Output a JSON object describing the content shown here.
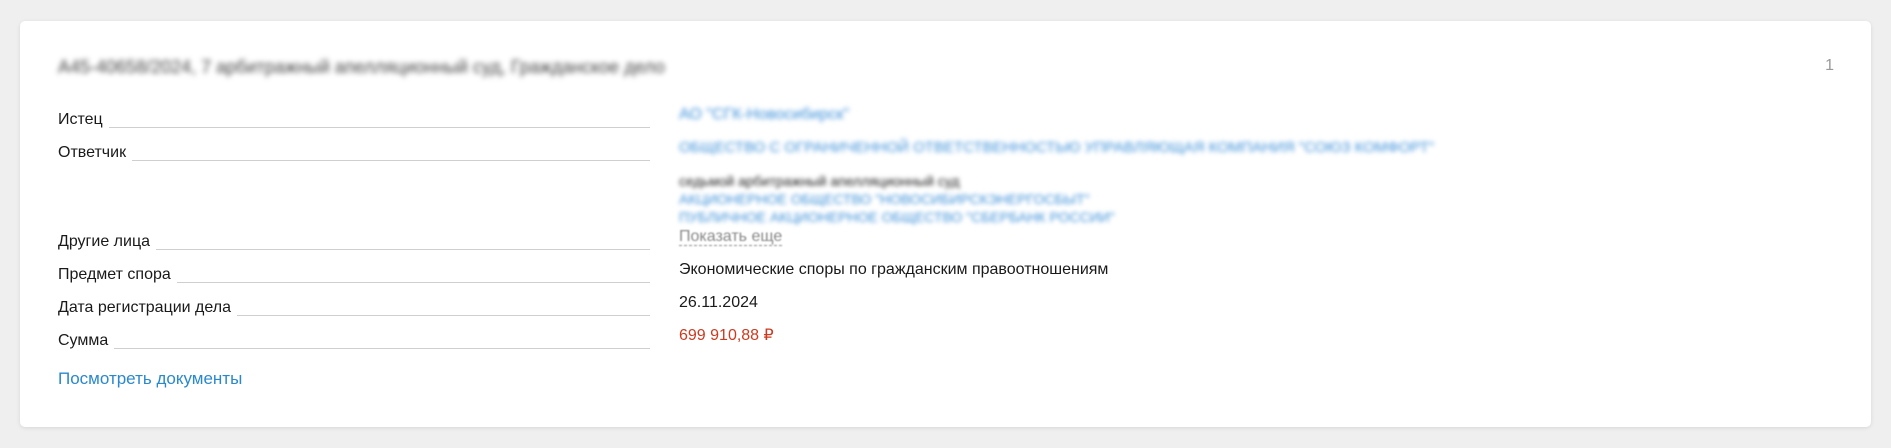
{
  "case": {
    "title": "А45-40658/2024, 7 арбитражный апелляционный суд, Гражданское дело",
    "page_number": "1"
  },
  "rows": {
    "plaintiff": {
      "label": "Истец",
      "value": "АО \"СГК-Новосибирск\""
    },
    "defendant": {
      "label": "Ответчик",
      "value": "ОБЩЕСТВО С ОГРАНИЧЕННОЙ ОТВЕТСТВЕННОСТЬЮ УПРАВЛЯЮЩАЯ КОМПАНИЯ \"СОЮЗ КОМФОРТ\""
    },
    "other_parties": {
      "label": "Другие лица",
      "court": "седьмой арбитражный апелляционный суд",
      "party_1": "АКЦИОНЕРНОЕ ОБЩЕСТВО \"НОВОСИБИРСКЭНЕРГОСБЫТ\"",
      "party_2": "ПУБЛИЧНОЕ АКЦИОНЕРНОЕ ОБЩЕСТВО \"СБЕРБАНК РОССИИ\"",
      "show_more": "Показать еще"
    },
    "subject": {
      "label": "Предмет спора",
      "value": "Экономические споры по гражданским правоотношениям"
    },
    "registration_date": {
      "label": "Дата регистрации дела",
      "value": "26.11.2024"
    },
    "amount": {
      "label": "Сумма",
      "value": "699 910,88 ₽"
    }
  },
  "actions": {
    "view_documents": "Посмотреть документы"
  },
  "colors": {
    "link": "#2a88cf",
    "amount": "#cc3a1f",
    "background": "#efefef",
    "card": "#ffffff"
  }
}
